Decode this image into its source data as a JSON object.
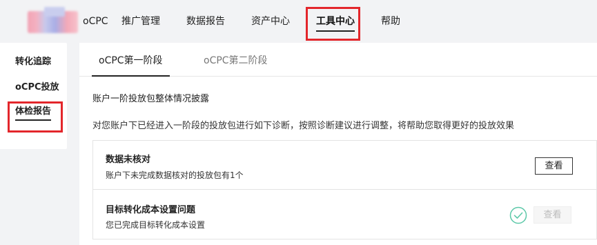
{
  "nav": {
    "items": [
      {
        "label": "oCPC"
      },
      {
        "label": "推广管理"
      },
      {
        "label": "数据报告"
      },
      {
        "label": "资产中心"
      },
      {
        "label": "工具中心"
      },
      {
        "label": "帮助"
      }
    ],
    "active_index": 4
  },
  "sidebar": {
    "items": [
      {
        "label": "转化追踪"
      },
      {
        "label": "oCPC投放"
      },
      {
        "label": "体检报告"
      }
    ],
    "active_index": 2
  },
  "tabs": [
    {
      "label": "oCPC第一阶段"
    },
    {
      "label": "oCPC第二阶段"
    }
  ],
  "section": {
    "title": "账户一阶投放包整体情况披露",
    "desc": "对您账户下已经进入一阶段的投放包进行如下诊断，按照诊断建议进行调整，将帮助您取得更好的投放效果"
  },
  "cards": [
    {
      "title": "数据未核对",
      "sub": "账户下未完成数据核对的投放包有1个",
      "button": "查看",
      "status": "pending"
    },
    {
      "title": "目标转化成本设置问题",
      "sub": "您已完成目标转化成本设置",
      "button": "查看",
      "status": "done",
      "status_icon": "check-circle-icon"
    }
  ],
  "colors": {
    "highlight": "#e3262b",
    "check": "#5cc8a8"
  }
}
